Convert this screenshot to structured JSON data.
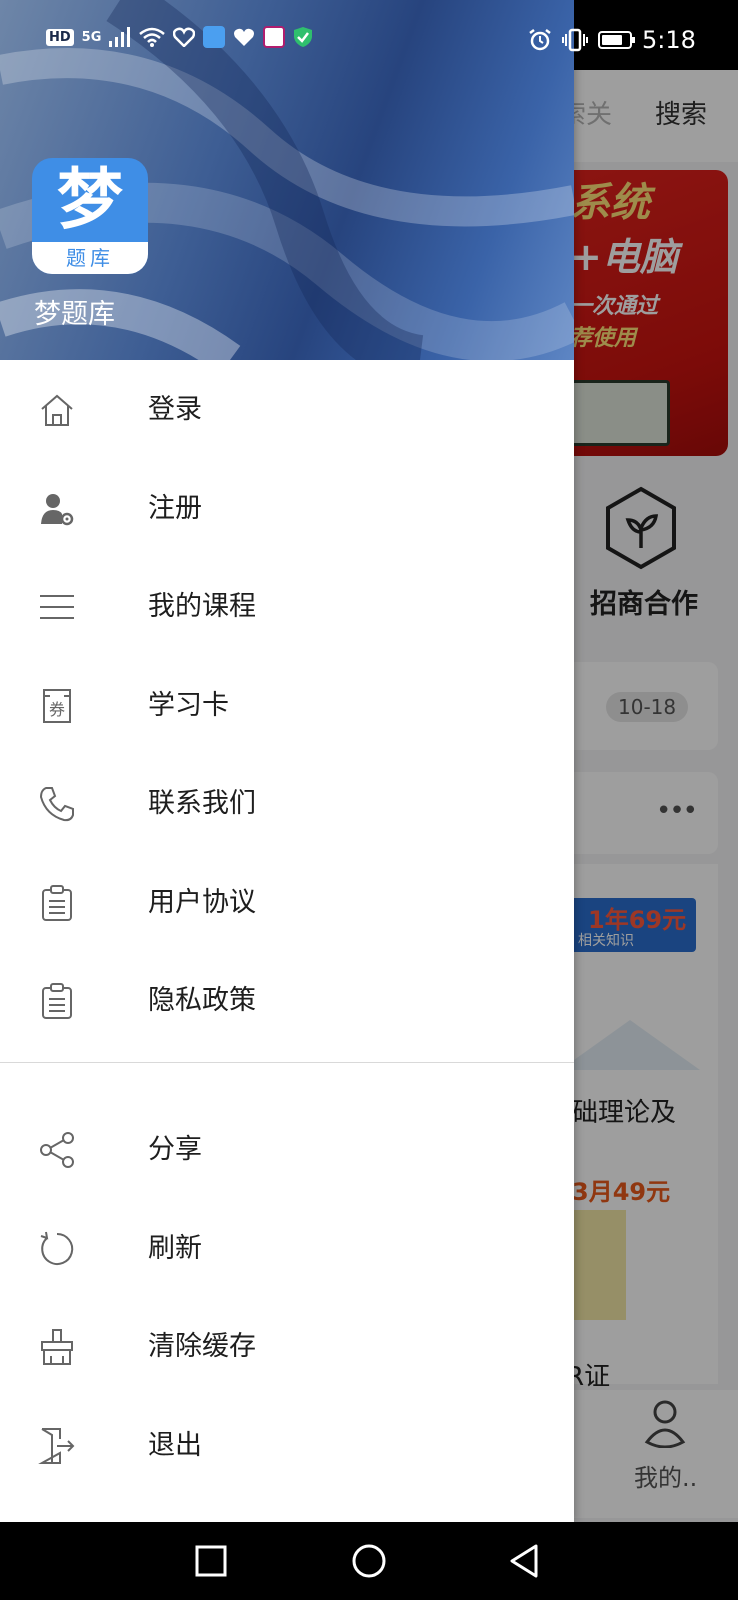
{
  "status_bar": {
    "left_badges": [
      "HD",
      "5G"
    ],
    "time": "5:18",
    "battery_level": 0.75
  },
  "background_app": {
    "search_fragment": "索关",
    "search_button": "搜索",
    "banner_lines": [
      "系统",
      "+电脑",
      "一次通过",
      "荐使用"
    ],
    "partner_label": "招商合作",
    "date_badge": "10-18",
    "more": "•••",
    "promo1": "1年69元",
    "promo1_sub": "相关知识",
    "course_title_fragment": "础理论及",
    "promo2": "3月49元",
    "course_title_fragment2": "R证",
    "tab_mine": "我的.."
  },
  "drawer": {
    "app_name": "梦题库",
    "logo_main": "梦",
    "logo_sub": "题库",
    "menu": [
      {
        "label": "登录",
        "icon": "home-icon"
      },
      {
        "label": "注册",
        "icon": "user-gear-icon"
      },
      {
        "label": "我的课程",
        "icon": "lines-icon"
      },
      {
        "label": "学习卡",
        "icon": "coupon-icon"
      },
      {
        "label": "联系我们",
        "icon": "phone-icon"
      },
      {
        "label": "用户协议",
        "icon": "clipboard-icon"
      },
      {
        "label": "隐私政策",
        "icon": "clipboard-icon"
      }
    ],
    "menu2": [
      {
        "label": "分享",
        "icon": "share-icon"
      },
      {
        "label": "刷新",
        "icon": "refresh-icon"
      },
      {
        "label": "清除缓存",
        "icon": "broom-icon"
      },
      {
        "label": "退出",
        "icon": "exit-icon"
      }
    ],
    "coupon_char": "券"
  },
  "colors": {
    "logo_blue": "#3f8ee6",
    "header_blue": "#27447e",
    "banner_red": "#e1221d"
  }
}
